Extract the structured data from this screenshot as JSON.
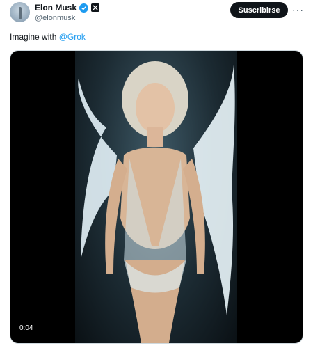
{
  "author": {
    "name": "Elon Musk",
    "handle": "@elonmusk",
    "avatar_icon": "profile-photo",
    "verified_icon": "verified-badge-icon",
    "affiliation_icon": "x-logo-icon"
  },
  "actions": {
    "subscribe_label": "Suscribirse",
    "more_label": "···"
  },
  "tweet": {
    "text": "Imagine with ",
    "mention": "@Grok"
  },
  "media": {
    "type": "video",
    "duration": "0:04",
    "description_icon": "video-thumbnail"
  },
  "colors": {
    "accent": "#1d9bf0",
    "button_bg": "#0f1419",
    "muted_text": "#536471"
  }
}
